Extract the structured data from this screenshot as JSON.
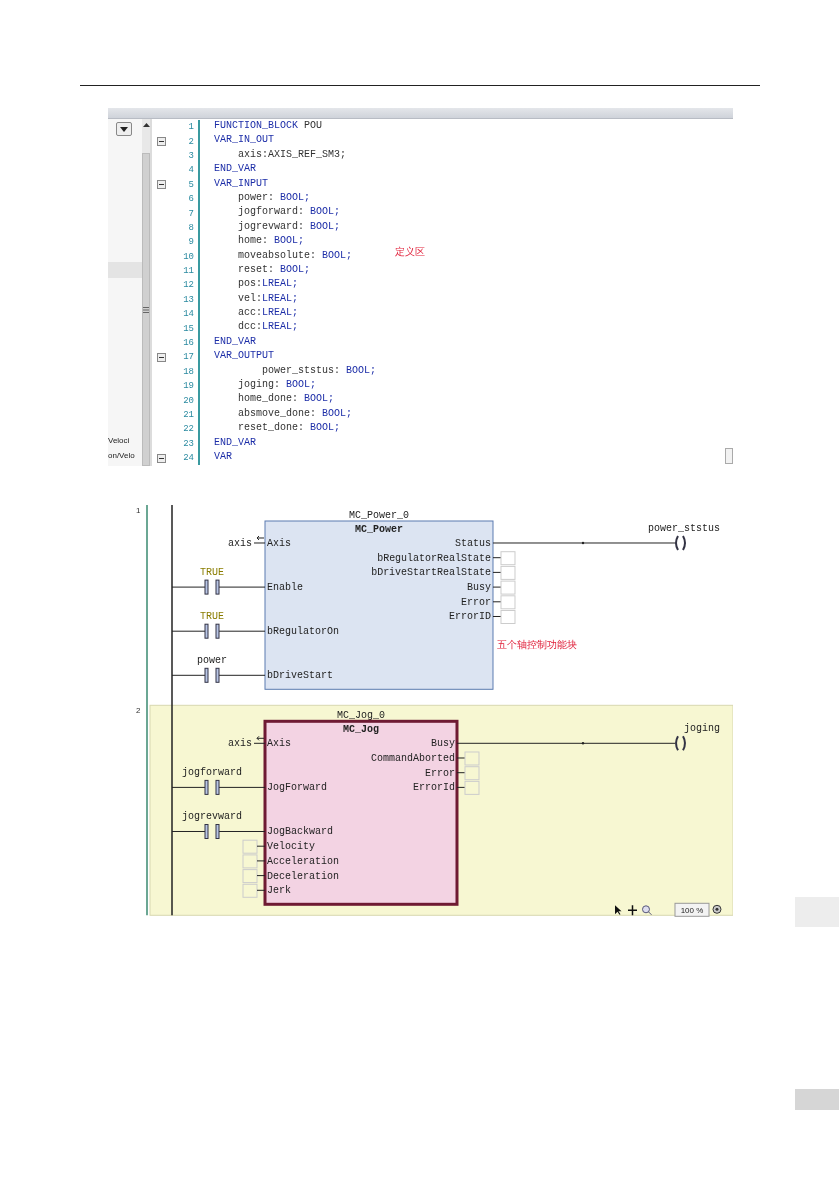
{
  "code_editor": {
    "side_panel": {
      "items": [
        "Veloci",
        "on/Velo"
      ]
    },
    "lines": [
      {
        "number": "1",
        "fold": false,
        "segments": [
          {
            "kind": "keyword",
            "text": "FUNCTION_BLOCK"
          },
          {
            "kind": "plain",
            "text": " POU"
          }
        ]
      },
      {
        "number": "2",
        "fold": true,
        "segments": [
          {
            "kind": "keyword",
            "text": "VAR_IN_OUT"
          }
        ]
      },
      {
        "number": "3",
        "fold": false,
        "segments": [
          {
            "kind": "plain",
            "text": "    axis:AXIS_REF_SM3;"
          }
        ]
      },
      {
        "number": "4",
        "fold": false,
        "segments": [
          {
            "kind": "keyword",
            "text": "END_VAR"
          }
        ]
      },
      {
        "number": "5",
        "fold": true,
        "segments": [
          {
            "kind": "keyword",
            "text": "VAR_INPUT"
          }
        ]
      },
      {
        "number": "6",
        "fold": false,
        "segments": [
          {
            "kind": "plain",
            "text": "    power: "
          },
          {
            "kind": "keyword",
            "text": "BOOL;"
          }
        ]
      },
      {
        "number": "7",
        "fold": false,
        "segments": [
          {
            "kind": "plain",
            "text": "    jogforward: "
          },
          {
            "kind": "keyword",
            "text": "BOOL;"
          }
        ]
      },
      {
        "number": "8",
        "fold": false,
        "segments": [
          {
            "kind": "plain",
            "text": "    jogrevward: "
          },
          {
            "kind": "keyword",
            "text": "BOOL;"
          }
        ]
      },
      {
        "number": "9",
        "fold": false,
        "segments": [
          {
            "kind": "plain",
            "text": "    home: "
          },
          {
            "kind": "keyword",
            "text": "BOOL;"
          }
        ]
      },
      {
        "number": "10",
        "fold": false,
        "segments": [
          {
            "kind": "plain",
            "text": "    moveabsolute: "
          },
          {
            "kind": "keyword",
            "text": "BOOL;"
          }
        ]
      },
      {
        "number": "11",
        "fold": false,
        "segments": [
          {
            "kind": "plain",
            "text": "    reset: "
          },
          {
            "kind": "keyword",
            "text": "BOOL;"
          }
        ]
      },
      {
        "number": "12",
        "fold": false,
        "segments": [
          {
            "kind": "plain",
            "text": "    pos:"
          },
          {
            "kind": "keyword",
            "text": "LREAL;"
          }
        ]
      },
      {
        "number": "13",
        "fold": false,
        "segments": [
          {
            "kind": "plain",
            "text": "    vel:"
          },
          {
            "kind": "keyword",
            "text": "LREAL;"
          }
        ]
      },
      {
        "number": "14",
        "fold": false,
        "segments": [
          {
            "kind": "plain",
            "text": "    acc:"
          },
          {
            "kind": "keyword",
            "text": "LREAL;"
          }
        ]
      },
      {
        "number": "15",
        "fold": false,
        "segments": [
          {
            "kind": "plain",
            "text": "    dcc:"
          },
          {
            "kind": "keyword",
            "text": "LREAL;"
          }
        ]
      },
      {
        "number": "16",
        "fold": false,
        "segments": [
          {
            "kind": "keyword",
            "text": "END_VAR"
          }
        ]
      },
      {
        "number": "17",
        "fold": true,
        "segments": [
          {
            "kind": "keyword",
            "text": "VAR_OUTPUT"
          }
        ]
      },
      {
        "number": "18",
        "fold": false,
        "segments": [
          {
            "kind": "plain",
            "text": "        power_ststus: "
          },
          {
            "kind": "keyword",
            "text": "BOOL;"
          }
        ]
      },
      {
        "number": "19",
        "fold": false,
        "segments": [
          {
            "kind": "plain",
            "text": "    joging: "
          },
          {
            "kind": "keyword",
            "text": "BOOL;"
          }
        ]
      },
      {
        "number": "20",
        "fold": false,
        "segments": [
          {
            "kind": "plain",
            "text": "    home_done: "
          },
          {
            "kind": "keyword",
            "text": "BOOL;"
          }
        ]
      },
      {
        "number": "21",
        "fold": false,
        "segments": [
          {
            "kind": "plain",
            "text": "    absmove_done: "
          },
          {
            "kind": "keyword",
            "text": "BOOL;"
          }
        ]
      },
      {
        "number": "22",
        "fold": false,
        "segments": [
          {
            "kind": "plain",
            "text": "    reset_done: "
          },
          {
            "kind": "keyword",
            "text": "BOOL;"
          }
        ]
      },
      {
        "number": "23",
        "fold": false,
        "segments": [
          {
            "kind": "keyword",
            "text": "END_VAR"
          }
        ]
      },
      {
        "number": "24",
        "fold": true,
        "segments": [
          {
            "kind": "keyword",
            "text": "VAR"
          }
        ]
      }
    ],
    "annotation": "定义区"
  },
  "ladder": {
    "networks": [
      {
        "number": "1",
        "selected": false,
        "instance": "MC_Power_0",
        "type": "MC_Power",
        "inputs": [
          {
            "kind": "ref",
            "pin": "Axis",
            "variable": "axis"
          },
          {
            "kind": "contact",
            "pin": "Enable",
            "variable": "TRUE",
            "constant": true
          },
          {
            "kind": "contact",
            "pin": "bRegulatorOn",
            "variable": "TRUE",
            "constant": true
          },
          {
            "kind": "contact",
            "pin": "bDriveStart",
            "variable": "power",
            "constant": false
          }
        ],
        "outputs": [
          {
            "kind": "coil",
            "pin": "Status",
            "variable": "power_ststus"
          },
          {
            "kind": "empty",
            "pin": "bRegulatorRealState"
          },
          {
            "kind": "empty",
            "pin": "bDriveStartRealState"
          },
          {
            "kind": "empty",
            "pin": "Busy"
          },
          {
            "kind": "empty",
            "pin": "Error"
          },
          {
            "kind": "empty",
            "pin": "ErrorID"
          }
        ]
      },
      {
        "number": "2",
        "selected": true,
        "instance": "MC_Jog_0",
        "type": "MC_Jog",
        "inputs": [
          {
            "kind": "ref",
            "pin": "Axis",
            "variable": "axis"
          },
          {
            "kind": "contact",
            "pin": "JogForward",
            "variable": "jogforward",
            "constant": false
          },
          {
            "kind": "contact",
            "pin": "JogBackward",
            "variable": "jogrevward",
            "constant": false
          },
          {
            "kind": "empty",
            "pin": "Velocity"
          },
          {
            "kind": "empty",
            "pin": "Acceleration"
          },
          {
            "kind": "empty",
            "pin": "Deceleration"
          },
          {
            "kind": "empty",
            "pin": "Jerk"
          }
        ],
        "outputs": [
          {
            "kind": "coil",
            "pin": "Busy",
            "variable": "joging"
          },
          {
            "kind": "empty",
            "pin": "CommandAborted"
          },
          {
            "kind": "empty",
            "pin": "Error"
          },
          {
            "kind": "empty",
            "pin": "ErrorId"
          }
        ]
      }
    ],
    "annotation": "五个轴控制功能块",
    "zoom": "100 %"
  }
}
